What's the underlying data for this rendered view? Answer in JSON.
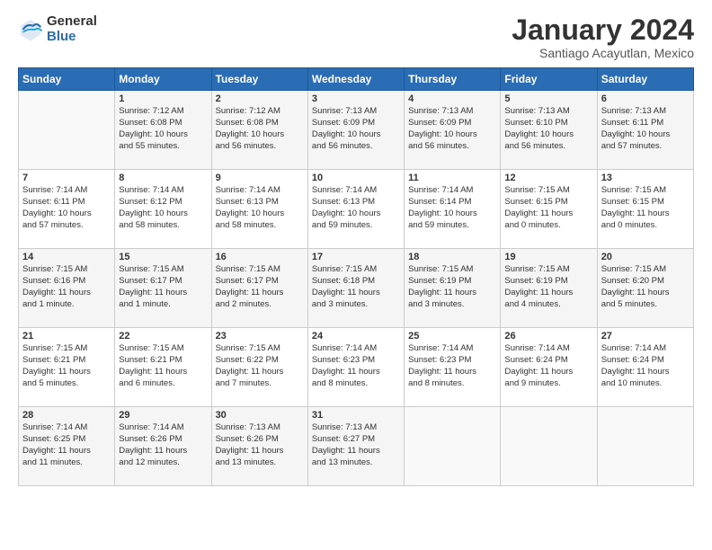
{
  "logo": {
    "general": "General",
    "blue": "Blue"
  },
  "title": "January 2024",
  "location": "Santiago Acayutlan, Mexico",
  "days_of_week": [
    "Sunday",
    "Monday",
    "Tuesday",
    "Wednesday",
    "Thursday",
    "Friday",
    "Saturday"
  ],
  "weeks": [
    [
      {
        "day": "",
        "info": ""
      },
      {
        "day": "1",
        "info": "Sunrise: 7:12 AM\nSunset: 6:08 PM\nDaylight: 10 hours\nand 55 minutes."
      },
      {
        "day": "2",
        "info": "Sunrise: 7:12 AM\nSunset: 6:08 PM\nDaylight: 10 hours\nand 56 minutes."
      },
      {
        "day": "3",
        "info": "Sunrise: 7:13 AM\nSunset: 6:09 PM\nDaylight: 10 hours\nand 56 minutes."
      },
      {
        "day": "4",
        "info": "Sunrise: 7:13 AM\nSunset: 6:09 PM\nDaylight: 10 hours\nand 56 minutes."
      },
      {
        "day": "5",
        "info": "Sunrise: 7:13 AM\nSunset: 6:10 PM\nDaylight: 10 hours\nand 56 minutes."
      },
      {
        "day": "6",
        "info": "Sunrise: 7:13 AM\nSunset: 6:11 PM\nDaylight: 10 hours\nand 57 minutes."
      }
    ],
    [
      {
        "day": "7",
        "info": "Sunrise: 7:14 AM\nSunset: 6:11 PM\nDaylight: 10 hours\nand 57 minutes."
      },
      {
        "day": "8",
        "info": "Sunrise: 7:14 AM\nSunset: 6:12 PM\nDaylight: 10 hours\nand 58 minutes."
      },
      {
        "day": "9",
        "info": "Sunrise: 7:14 AM\nSunset: 6:13 PM\nDaylight: 10 hours\nand 58 minutes."
      },
      {
        "day": "10",
        "info": "Sunrise: 7:14 AM\nSunset: 6:13 PM\nDaylight: 10 hours\nand 59 minutes."
      },
      {
        "day": "11",
        "info": "Sunrise: 7:14 AM\nSunset: 6:14 PM\nDaylight: 10 hours\nand 59 minutes."
      },
      {
        "day": "12",
        "info": "Sunrise: 7:15 AM\nSunset: 6:15 PM\nDaylight: 11 hours\nand 0 minutes."
      },
      {
        "day": "13",
        "info": "Sunrise: 7:15 AM\nSunset: 6:15 PM\nDaylight: 11 hours\nand 0 minutes."
      }
    ],
    [
      {
        "day": "14",
        "info": "Sunrise: 7:15 AM\nSunset: 6:16 PM\nDaylight: 11 hours\nand 1 minute."
      },
      {
        "day": "15",
        "info": "Sunrise: 7:15 AM\nSunset: 6:17 PM\nDaylight: 11 hours\nand 1 minute."
      },
      {
        "day": "16",
        "info": "Sunrise: 7:15 AM\nSunset: 6:17 PM\nDaylight: 11 hours\nand 2 minutes."
      },
      {
        "day": "17",
        "info": "Sunrise: 7:15 AM\nSunset: 6:18 PM\nDaylight: 11 hours\nand 3 minutes."
      },
      {
        "day": "18",
        "info": "Sunrise: 7:15 AM\nSunset: 6:19 PM\nDaylight: 11 hours\nand 3 minutes."
      },
      {
        "day": "19",
        "info": "Sunrise: 7:15 AM\nSunset: 6:19 PM\nDaylight: 11 hours\nand 4 minutes."
      },
      {
        "day": "20",
        "info": "Sunrise: 7:15 AM\nSunset: 6:20 PM\nDaylight: 11 hours\nand 5 minutes."
      }
    ],
    [
      {
        "day": "21",
        "info": "Sunrise: 7:15 AM\nSunset: 6:21 PM\nDaylight: 11 hours\nand 5 minutes."
      },
      {
        "day": "22",
        "info": "Sunrise: 7:15 AM\nSunset: 6:21 PM\nDaylight: 11 hours\nand 6 minutes."
      },
      {
        "day": "23",
        "info": "Sunrise: 7:15 AM\nSunset: 6:22 PM\nDaylight: 11 hours\nand 7 minutes."
      },
      {
        "day": "24",
        "info": "Sunrise: 7:14 AM\nSunset: 6:23 PM\nDaylight: 11 hours\nand 8 minutes."
      },
      {
        "day": "25",
        "info": "Sunrise: 7:14 AM\nSunset: 6:23 PM\nDaylight: 11 hours\nand 8 minutes."
      },
      {
        "day": "26",
        "info": "Sunrise: 7:14 AM\nSunset: 6:24 PM\nDaylight: 11 hours\nand 9 minutes."
      },
      {
        "day": "27",
        "info": "Sunrise: 7:14 AM\nSunset: 6:24 PM\nDaylight: 11 hours\nand 10 minutes."
      }
    ],
    [
      {
        "day": "28",
        "info": "Sunrise: 7:14 AM\nSunset: 6:25 PM\nDaylight: 11 hours\nand 11 minutes."
      },
      {
        "day": "29",
        "info": "Sunrise: 7:14 AM\nSunset: 6:26 PM\nDaylight: 11 hours\nand 12 minutes."
      },
      {
        "day": "30",
        "info": "Sunrise: 7:13 AM\nSunset: 6:26 PM\nDaylight: 11 hours\nand 13 minutes."
      },
      {
        "day": "31",
        "info": "Sunrise: 7:13 AM\nSunset: 6:27 PM\nDaylight: 11 hours\nand 13 minutes."
      },
      {
        "day": "",
        "info": ""
      },
      {
        "day": "",
        "info": ""
      },
      {
        "day": "",
        "info": ""
      }
    ]
  ]
}
